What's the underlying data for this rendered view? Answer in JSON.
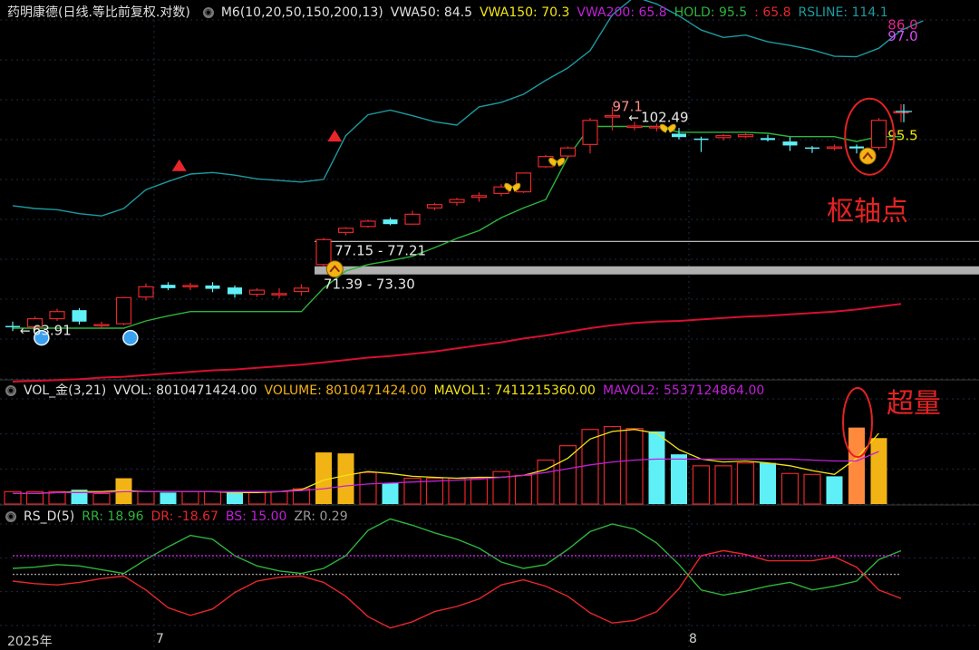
{
  "colors": {
    "up": "#e8262a",
    "down": "#5ff0f7",
    "teal": "#1c9aa0",
    "green": "#2db43c",
    "crimson": "#d51030",
    "gold": "#f2b315",
    "magenta": "#c020d8",
    "grid": "#1e2a40",
    "label": "#cfcfcf",
    "orange": "#ff8a3d"
  },
  "price_header": {
    "title": "药明康德(日线.等比前复权.对数)",
    "m6": "M6(10,20,50,150,200,13)",
    "vwa50": "VWA50: 84.5",
    "vwa150": "VWA150: 70.3",
    "vwa200": "VWA200: 65.8",
    "hold": "HOLD: 95.5",
    "colon": ": 65.8",
    "rsline": "RSLINE: 114.1"
  },
  "vol_header": {
    "title": "VOL_金(3,21)",
    "vvol": "VVOL: 8010471424.00",
    "volume": "VOLUME: 8010471424.00",
    "mavol1": "MAVOL1: 7411215360.00",
    "mavol2": "MAVOL2: 5537124864.00"
  },
  "rs_header": {
    "title": "RS_D(5)",
    "rr": "RR: 18.96",
    "dr": "DR: -18.67",
    "bs": "BS: 15.00",
    "zr": "ZR: 0.29"
  },
  "annotations": {
    "pivot": "枢轴点",
    "surge": "超量"
  },
  "x_axis": {
    "year": "2025年",
    "m7": "7",
    "m8": "8"
  },
  "chart_data": [
    {
      "type": "candlestick",
      "title": "药明康德(日线.等比前复权.对数)",
      "scale": "log",
      "ylim": [
        58,
        122
      ],
      "candles": [
        [
          64.2,
          64.8,
          63.5,
          64.1
        ],
        [
          64.1,
          65.5,
          63.7,
          65.2
        ],
        [
          65.2,
          66.6,
          64.9,
          66.2
        ],
        [
          66.4,
          66.7,
          64.4,
          64.8
        ],
        [
          64.3,
          64.8,
          63.9,
          64.4
        ],
        [
          64.5,
          68.3,
          64.3,
          68.2
        ],
        [
          68.3,
          70.3,
          67.8,
          69.8
        ],
        [
          70.1,
          70.5,
          69.3,
          69.6
        ],
        [
          69.8,
          70.4,
          69.3,
          70.0
        ],
        [
          70.0,
          70.5,
          69.0,
          69.5
        ],
        [
          69.7,
          70.0,
          68.2,
          68.7
        ],
        [
          68.7,
          69.6,
          68.3,
          69.3
        ],
        [
          68.7,
          69.6,
          68.1,
          68.8
        ],
        [
          69.1,
          70.2,
          68.5,
          69.6
        ],
        [
          73.2,
          77.5,
          72.9,
          77.2
        ],
        [
          78.4,
          79.3,
          77.9,
          79.1
        ],
        [
          79.4,
          80.6,
          79.2,
          80.3
        ],
        [
          80.6,
          80.9,
          79.6,
          79.8
        ],
        [
          79.8,
          82.1,
          79.7,
          81.5
        ],
        [
          82.6,
          83.5,
          82.2,
          83.2
        ],
        [
          83.6,
          84.4,
          83.0,
          84.1
        ],
        [
          84.5,
          85.4,
          83.7,
          84.8
        ],
        [
          85.2,
          86.9,
          84.7,
          86.4
        ],
        [
          85.5,
          89.1,
          85.3,
          89.0
        ],
        [
          90.2,
          92.5,
          90.0,
          92.2
        ],
        [
          92.3,
          94.2,
          91.9,
          93.9
        ],
        [
          94.6,
          100.1,
          92.8,
          99.6
        ],
        [
          100.3,
          102.5,
          97.5,
          100.6
        ],
        [
          98.1,
          99.3,
          97.5,
          98.4
        ],
        [
          98.1,
          98.9,
          97.3,
          98.3
        ],
        [
          96.8,
          98.0,
          95.6,
          96.1
        ],
        [
          95.8,
          96.2,
          93.1,
          95.6
        ],
        [
          96.0,
          96.7,
          95.4,
          96.4
        ],
        [
          96.2,
          96.9,
          95.9,
          96.6
        ],
        [
          95.9,
          96.6,
          95.2,
          95.5
        ],
        [
          95.2,
          96.1,
          93.3,
          94.4
        ],
        [
          94.0,
          94.3,
          92.9,
          93.8
        ],
        [
          94.1,
          94.6,
          93.4,
          94.1
        ],
        [
          94.2,
          94.6,
          92.8,
          93.8
        ],
        [
          94.0,
          100.1,
          93.5,
          99.6
        ],
        [
          101.3,
          103.1,
          99.2,
          101.5
        ]
      ],
      "series": [
        {
          "name": "RSLINE",
          "values": [
            83,
            82.5,
            82.3,
            81.6,
            81.2,
            82.5,
            85.9,
            87.4,
            88.8,
            89.1,
            88.6,
            87.9,
            87.6,
            87.3,
            87.8,
            96.4,
            100.8,
            101.8,
            100.6,
            99.3,
            98.6,
            102.5,
            103.5,
            105.3,
            108.5,
            111.4,
            115.6,
            124.8,
            129.7,
            127.7,
            124.5,
            120.8,
            118.9,
            119.5,
            117.8,
            116.9,
            115.8,
            114.2,
            114.1,
            116.2,
            120.7,
            123.2
          ]
        },
        {
          "name": "HOLD",
          "values": [
            63.9,
            63.9,
            63.9,
            63.9,
            63.9,
            63.9,
            64.9,
            65.6,
            66.2,
            66.2,
            66.2,
            66.2,
            66.2,
            66.2,
            69.6,
            72.2,
            73.2,
            73.8,
            74.5,
            75.9,
            77.4,
            78.7,
            80.9,
            82.6,
            84.1,
            92.1,
            98.3,
            98.3,
            98.3,
            98.3,
            97.1,
            97.1,
            97.1,
            97.1,
            96.9,
            96.2,
            96.2,
            96.2,
            95.2,
            96.2,
            96.2
          ]
        },
        {
          "name": "VWA200",
          "values": [
            57,
            57.1,
            57.2,
            57.3,
            57.5,
            57.6,
            57.8,
            58,
            58.2,
            58.4,
            58.5,
            58.7,
            58.9,
            59.1,
            59.4,
            59.7,
            60,
            60.2,
            60.5,
            60.8,
            61.2,
            61.6,
            62,
            62.5,
            62.9,
            63.4,
            63.9,
            64.3,
            64.6,
            64.8,
            64.9,
            65.1,
            65.3,
            65.5,
            65.6,
            65.8,
            66,
            66.2,
            66.5,
            66.9,
            67.3
          ]
        }
      ],
      "labels": [
        {
          "text": "97.1",
          "i": 27.0,
          "y": 101.6,
          "color": "#ff8c8c",
          "arrow": false
        },
        {
          "text": "102.49",
          "i": 27.8,
          "y": 99.3,
          "color": "#e8e8e8",
          "arrow": true
        },
        {
          "text": "77.15 - 77.21",
          "i": 14.5,
          "y": 74.7,
          "color": "#e8e8e8",
          "arrow": false
        },
        {
          "text": "71.39 - 73.30",
          "i": 14.0,
          "y": 69.5,
          "color": "#e8e8e8",
          "arrow": false
        },
        {
          "text": "63.91",
          "i": 0.4,
          "y": 63.0,
          "color": "#e8e8e8",
          "arrow": true
        },
        {
          "text": "86.0",
          "i": 39.4,
          "y": 121.0,
          "color": "#e0248c",
          "arrow": false
        },
        {
          "text": "97.0",
          "i": 39.4,
          "y": 118.0,
          "color": "#d84cf0",
          "arrow": false
        },
        {
          "text": "95.5",
          "i": 39.4,
          "y": 95.5,
          "color": "#f2e515",
          "arrow": false
        }
      ],
      "hlines": [
        {
          "y": 76.9,
          "color": "#cfcfcf",
          "from": 14.0
        },
        {
          "y": 72.3,
          "color": "#cfcfcf",
          "from": 14.0,
          "thick": true
        }
      ],
      "markers": [
        {
          "shape": "triangle",
          "i": 7.5,
          "y": 90.4
        },
        {
          "shape": "triangle",
          "i": 14.5,
          "y": 96.3
        },
        {
          "shape": "butterfly",
          "i": 22.5,
          "y": 86.4
        },
        {
          "shape": "butterfly",
          "i": 24.5,
          "y": 91.2
        },
        {
          "shape": "butterfly",
          "i": 29.5,
          "y": 98.0
        },
        {
          "shape": "up-coin",
          "i": 14.5,
          "y": 72.5
        },
        {
          "shape": "up-coin",
          "i": 38.5,
          "y": 92.3
        },
        {
          "shape": "ball",
          "i": 1.3,
          "y": 62.6
        },
        {
          "shape": "ball",
          "i": 5.3,
          "y": 62.6
        }
      ]
    },
    {
      "type": "bar",
      "title": "VOL_金(3,21)",
      "ylim": [
        0,
        11000000000.0
      ],
      "bar_kind": [
        "up",
        "up",
        "up",
        "down",
        "up",
        "gold",
        "up",
        "down",
        "up",
        "up",
        "down",
        "up",
        "up",
        "up",
        "gold",
        "gold",
        "up",
        "down",
        "up",
        "up",
        "up",
        "up",
        "up",
        "up",
        "up",
        "up",
        "up",
        "up",
        "up",
        "down",
        "down",
        "up",
        "up",
        "up",
        "down",
        "up",
        "up",
        "down",
        "surge",
        "gold"
      ],
      "values": [
        1300000000.0,
        1300000000.0,
        1300000000.0,
        1500000000.0,
        1100000000.0,
        2700000000.0,
        1300000000.0,
        1200000000.0,
        1300000000.0,
        1300000000.0,
        1200000000.0,
        1300000000.0,
        1300000000.0,
        1600000000.0,
        5400000000.0,
        5300000000.0,
        3300000000.0,
        2200000000.0,
        2700000000.0,
        2700000000.0,
        2700000000.0,
        2700000000.0,
        3400000000.0,
        3000000000.0,
        4600000000.0,
        6100000000.0,
        7800000000.0,
        8100000000.0,
        7900000000.0,
        7600000000.0,
        5200000000.0,
        4000000000.0,
        4000000000.0,
        4300000000.0,
        4300000000.0,
        3200000000.0,
        3100000000.0,
        2900000000.0,
        8000000000.0,
        6900000000.0
      ],
      "series": [
        {
          "name": "MAVOL1",
          "values": [
            1100000000.0,
            1100000000.0,
            1200000000.0,
            1300000000.0,
            1300000000.0,
            1400000000.0,
            1300000000.0,
            1300000000.0,
            1300000000.0,
            1300000000.0,
            1200000000.0,
            1200000000.0,
            1300000000.0,
            1500000000.0,
            2500000000.0,
            3000000000.0,
            3400000000.0,
            3200000000.0,
            2900000000.0,
            2800000000.0,
            2700000000.0,
            2800000000.0,
            2800000000.0,
            3000000000.0,
            3600000000.0,
            4800000000.0,
            6800000000.0,
            7600000000.0,
            7800000000.0,
            7400000000.0,
            5700000000.0,
            4700000000.0,
            4400000000.0,
            4500000000.0,
            4300000000.0,
            4000000000.0,
            3500000000.0,
            3100000000.0,
            4800000000.0,
            7400000000.0
          ]
        },
        {
          "name": "MAVOL2",
          "values": [
            1100000000.0,
            1100000000.0,
            1200000000.0,
            1200000000.0,
            1200000000.0,
            1300000000.0,
            1300000000.0,
            1300000000.0,
            1300000000.0,
            1300000000.0,
            1300000000.0,
            1300000000.0,
            1300000000.0,
            1400000000.0,
            1600000000.0,
            1900000000.0,
            2100000000.0,
            2200000000.0,
            2300000000.0,
            2400000000.0,
            2500000000.0,
            2600000000.0,
            2800000000.0,
            3000000000.0,
            3300000000.0,
            3700000000.0,
            4100000000.0,
            4400000000.0,
            4600000000.0,
            4700000000.0,
            4700000000.0,
            4700000000.0,
            4700000000.0,
            4700000000.0,
            4700000000.0,
            4700000000.0,
            4600000000.0,
            4500000000.0,
            4500000000.0,
            5500000000.0
          ]
        }
      ]
    },
    {
      "type": "line",
      "title": "RS_D(5)",
      "ylim": [
        -40,
        40
      ],
      "series": [
        {
          "name": "RR",
          "values": [
            5,
            6,
            8,
            7,
            4,
            1,
            12,
            22,
            31,
            28,
            15,
            7,
            3,
            1,
            5,
            15,
            35,
            44,
            39,
            33,
            28,
            21,
            10,
            5,
            8,
            20,
            34,
            40,
            36,
            25,
            8,
            -12,
            -16,
            -13,
            -9,
            -6,
            -12,
            -9,
            -5,
            12,
            18.96
          ]
        },
        {
          "name": "DR",
          "values": [
            -5,
            -7,
            -8,
            -6,
            -3,
            -1,
            -12,
            -26,
            -32,
            -27,
            -14,
            -5,
            -2,
            -1,
            -6,
            -17,
            -33,
            -42,
            -37,
            -29,
            -25,
            -19,
            -8,
            -4,
            -9,
            -17,
            -30,
            -38,
            -36,
            -29,
            -11,
            15,
            19,
            16,
            11,
            11,
            11,
            14,
            6,
            -12,
            -18.67
          ]
        },
        {
          "name": "BS",
          "values": [
            15,
            15,
            15,
            15,
            15,
            15,
            15,
            15,
            15,
            15,
            15,
            15,
            15,
            15,
            15,
            15,
            15,
            15,
            15,
            15,
            15,
            15,
            15,
            15,
            15,
            15,
            15,
            15,
            15,
            15,
            15,
            15,
            15,
            15,
            15,
            15,
            15,
            15,
            15,
            15,
            15
          ]
        },
        {
          "name": "ZR",
          "values": [
            0.29,
            0.29,
            0.29,
            0.29,
            0.29,
            0.29,
            0.29,
            0.29,
            0.29,
            0.29,
            0.29,
            0.29,
            0.29,
            0.29,
            0.29,
            0.29,
            0.29,
            0.29,
            0.29,
            0.29,
            0.29,
            0.29,
            0.29,
            0.29,
            0.29,
            0.29,
            0.29,
            0.29,
            0.29,
            0.29,
            0.29,
            0.29,
            0.29,
            0.29,
            0.29,
            0.29,
            0.29,
            0.29,
            0.29,
            0.29,
            0.29
          ]
        }
      ]
    }
  ]
}
